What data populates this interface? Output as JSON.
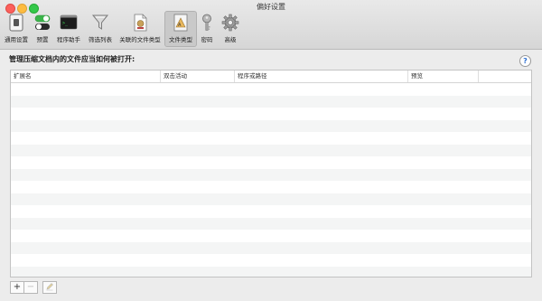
{
  "window": {
    "title": "偏好设置"
  },
  "toolbar": {
    "items": [
      {
        "label": "通用设置",
        "icon": "general-icon"
      },
      {
        "label": "预置",
        "icon": "toggle-icon"
      },
      {
        "label": "程序助手",
        "icon": "terminal-icon"
      },
      {
        "label": "筛选列表",
        "icon": "funnel-icon"
      },
      {
        "label": "关联的文件类型",
        "icon": "document-icon"
      },
      {
        "label": "文件类型",
        "icon": "file-type-icon",
        "selected": true
      },
      {
        "label": "密码",
        "icon": "key-icon"
      },
      {
        "label": "高级",
        "icon": "gear-icon"
      }
    ]
  },
  "main": {
    "heading": "管理压缩文档内的文件应当如何被打开:",
    "help": "?",
    "table": {
      "columns": [
        "扩展名",
        "双击活动",
        "程序或路径",
        "预览"
      ],
      "rows": []
    },
    "buttons": {
      "add": "+",
      "remove": "−"
    }
  }
}
